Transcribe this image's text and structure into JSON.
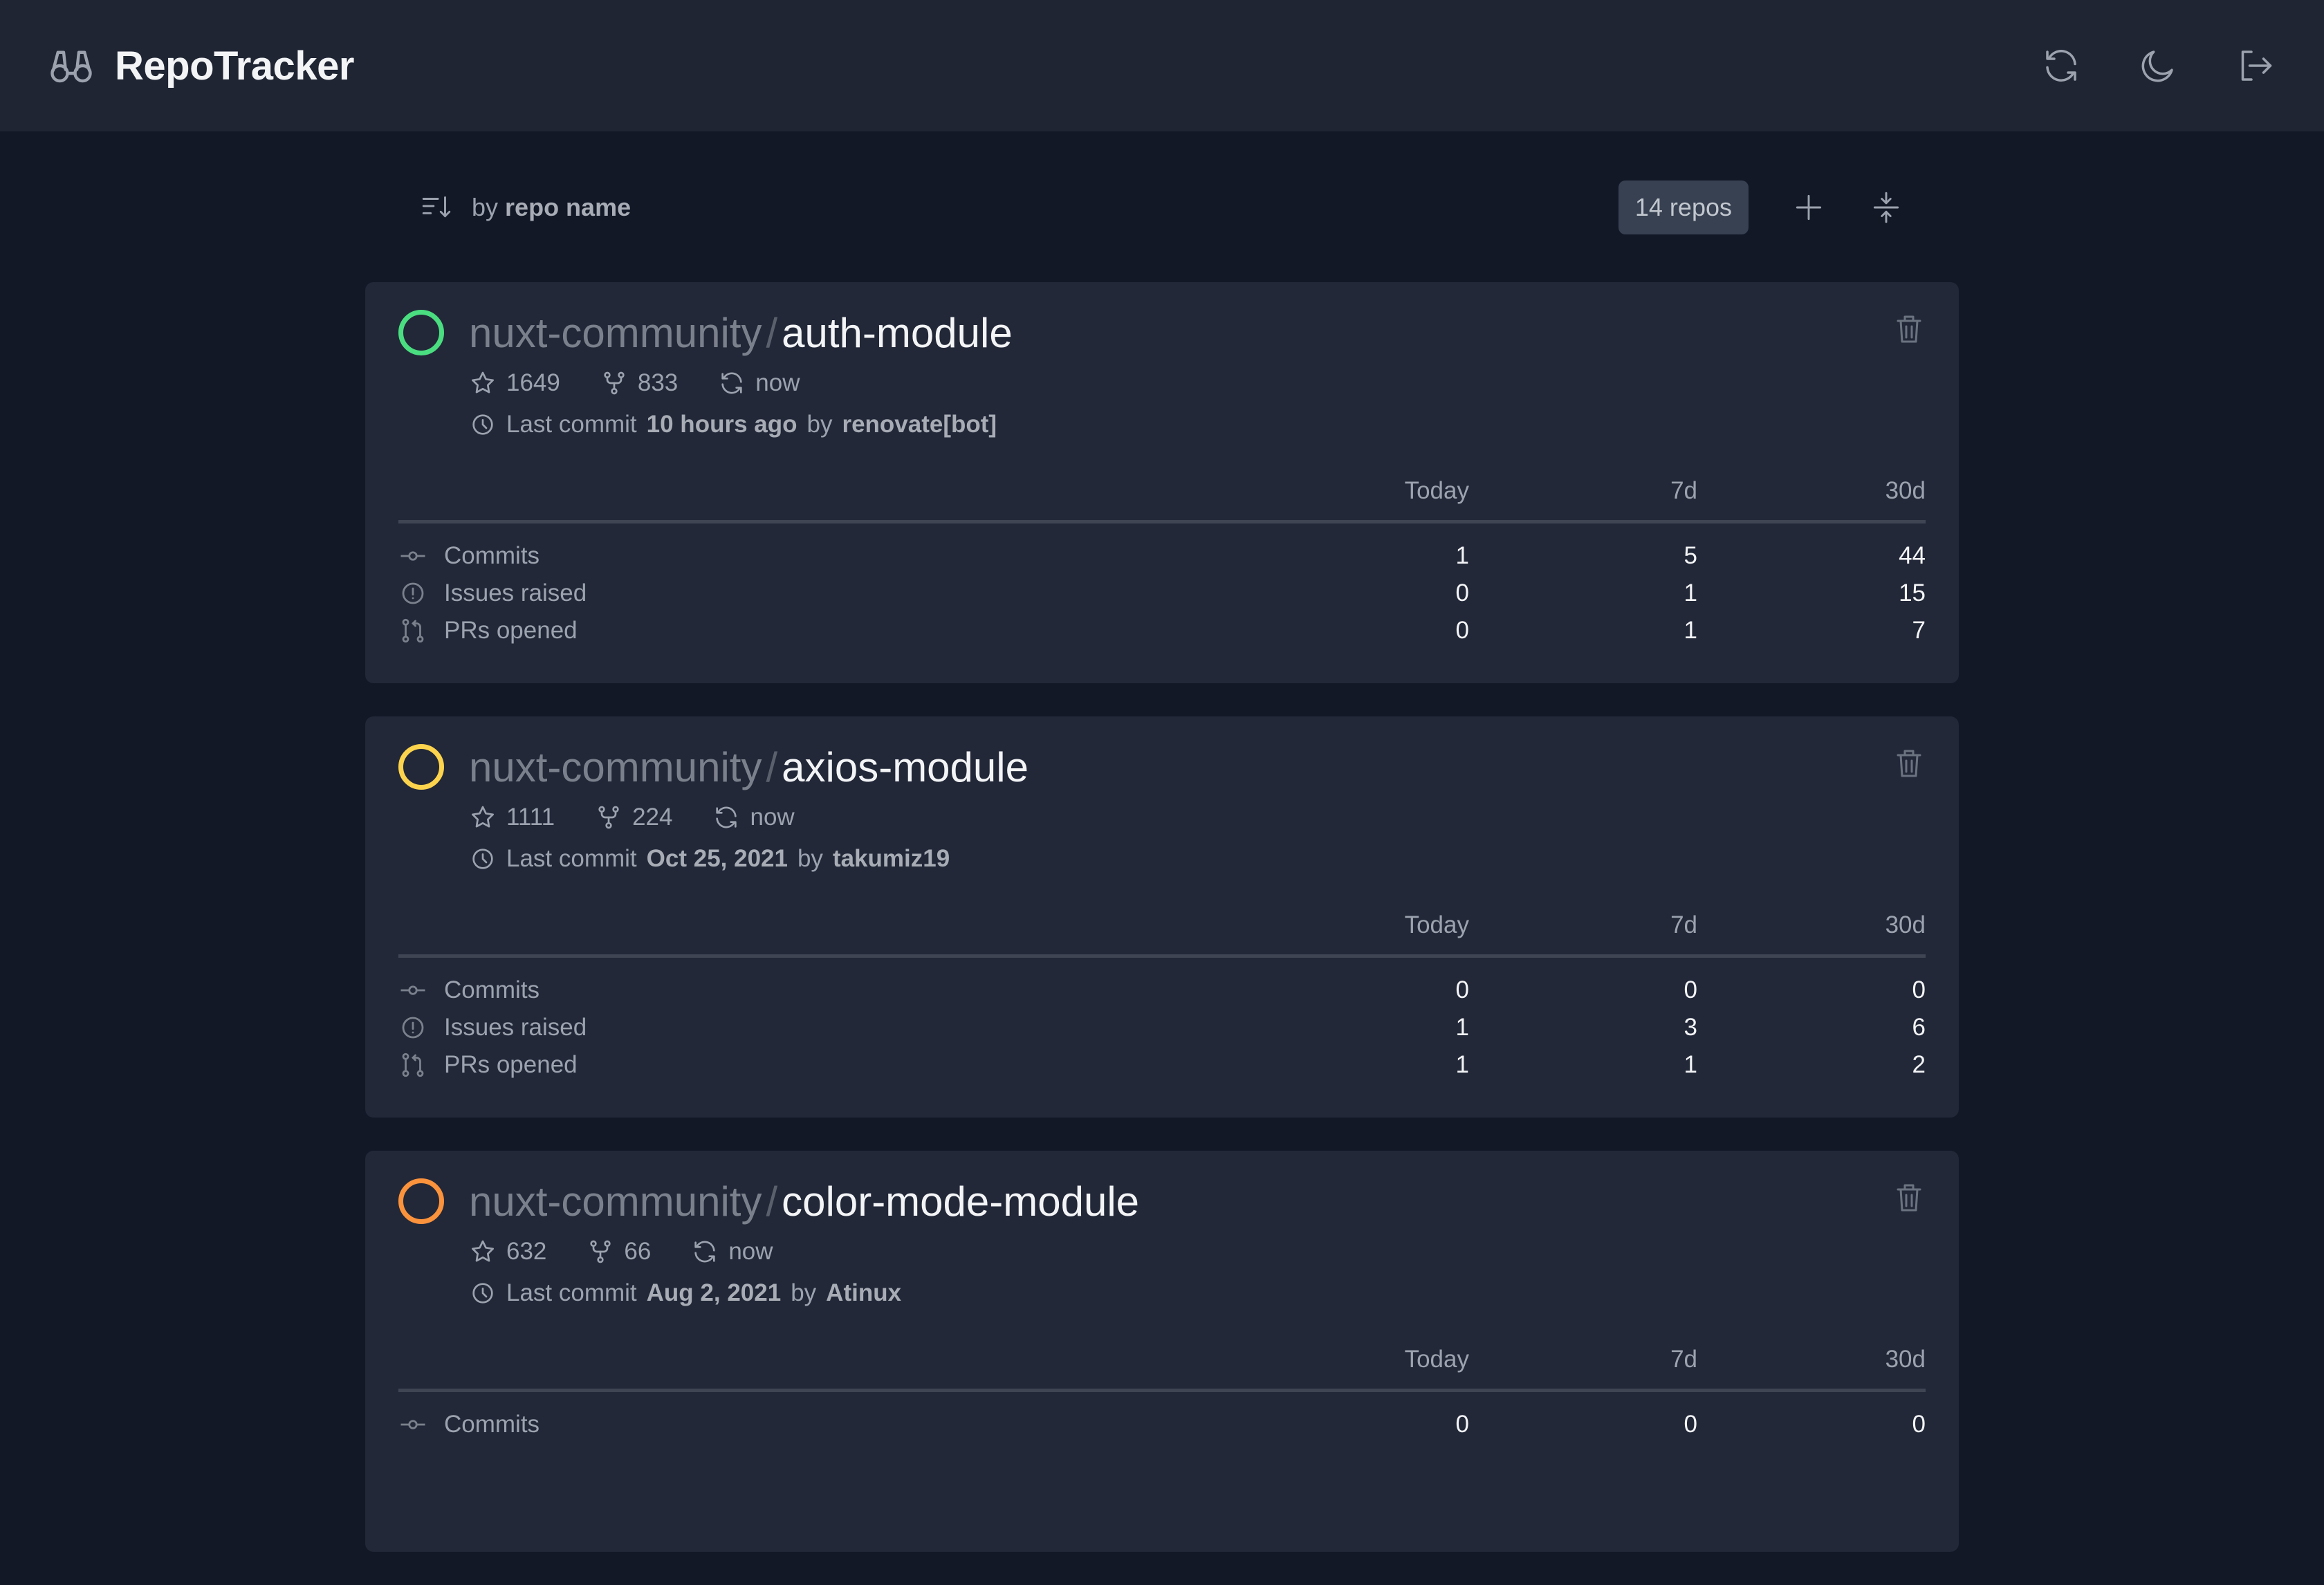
{
  "app": {
    "title": "RepoTracker"
  },
  "header": {
    "icons": [
      "binoculars-icon",
      "refresh-icon",
      "moon-icon",
      "logout-icon"
    ]
  },
  "toolbar": {
    "sort_prefix": "by",
    "sort_field": "repo name",
    "repo_count": "14 repos"
  },
  "columns": [
    "Today",
    "7d",
    "30d"
  ],
  "row_labels": [
    "Commits",
    "Issues raised",
    "PRs opened"
  ],
  "repos": [
    {
      "owner": "nuxt-community",
      "name": "auth-module",
      "status_color": "#4ade80",
      "stars": "1649",
      "forks": "833",
      "synced": "now",
      "last_commit_prefix": "Last commit",
      "last_commit_time": "10 hours ago",
      "by": "by",
      "last_commit_author": "renovate[bot]",
      "stats": {
        "commits": [
          "1",
          "5",
          "44"
        ],
        "issues": [
          "0",
          "1",
          "15"
        ],
        "prs": [
          "0",
          "1",
          "7"
        ]
      }
    },
    {
      "owner": "nuxt-community",
      "name": "axios-module",
      "status_color": "#fcd34d",
      "stars": "1111",
      "forks": "224",
      "synced": "now",
      "last_commit_prefix": "Last commit",
      "last_commit_time": "Oct 25, 2021",
      "by": "by",
      "last_commit_author": "takumiz19",
      "stats": {
        "commits": [
          "0",
          "0",
          "0"
        ],
        "issues": [
          "1",
          "3",
          "6"
        ],
        "prs": [
          "1",
          "1",
          "2"
        ]
      }
    },
    {
      "owner": "nuxt-community",
      "name": "color-mode-module",
      "status_color": "#fb923c",
      "stars": "632",
      "forks": "66",
      "synced": "now",
      "last_commit_prefix": "Last commit",
      "last_commit_time": "Aug 2, 2021",
      "by": "by",
      "last_commit_author": "Atinux",
      "stats": {
        "commits": [
          "0",
          "0",
          "0"
        ],
        "issues": [
          "",
          "",
          ""
        ],
        "prs": [
          "",
          "",
          ""
        ]
      }
    }
  ]
}
